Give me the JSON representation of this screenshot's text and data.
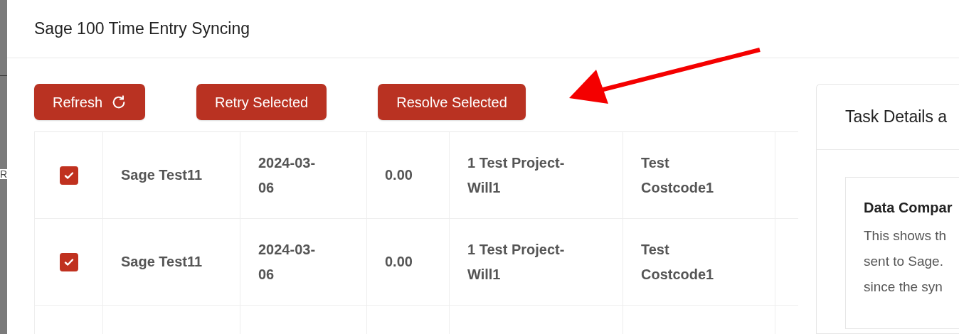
{
  "background_page": {
    "text": "R"
  },
  "modal": {
    "title": "Sage 100 Time Entry Syncing"
  },
  "toolbar": {
    "buttons": [
      {
        "label": "Refresh",
        "kind": "refresh"
      },
      {
        "label": "Retry Selected",
        "kind": "plain"
      },
      {
        "label": "Resolve Selected",
        "kind": "plain"
      }
    ]
  },
  "table": {
    "rows": [
      {
        "checked": true,
        "cells": [
          "Sage Test11",
          "2024-03-06",
          "0.00",
          "1 Test Project-Will1",
          "Test Costcode1"
        ]
      },
      {
        "checked": true,
        "cells": [
          "Sage Test11",
          "2024-03-06",
          "0.00",
          "1 Test Project-Will1",
          "Test Costcode1"
        ]
      }
    ]
  },
  "details_panel": {
    "title": "Task Details a",
    "section": {
      "title": "Data Compar",
      "lines": [
        "This shows th",
        "sent to Sage.",
        "since the syn"
      ]
    }
  },
  "annotation": {
    "kind": "arrow"
  }
}
